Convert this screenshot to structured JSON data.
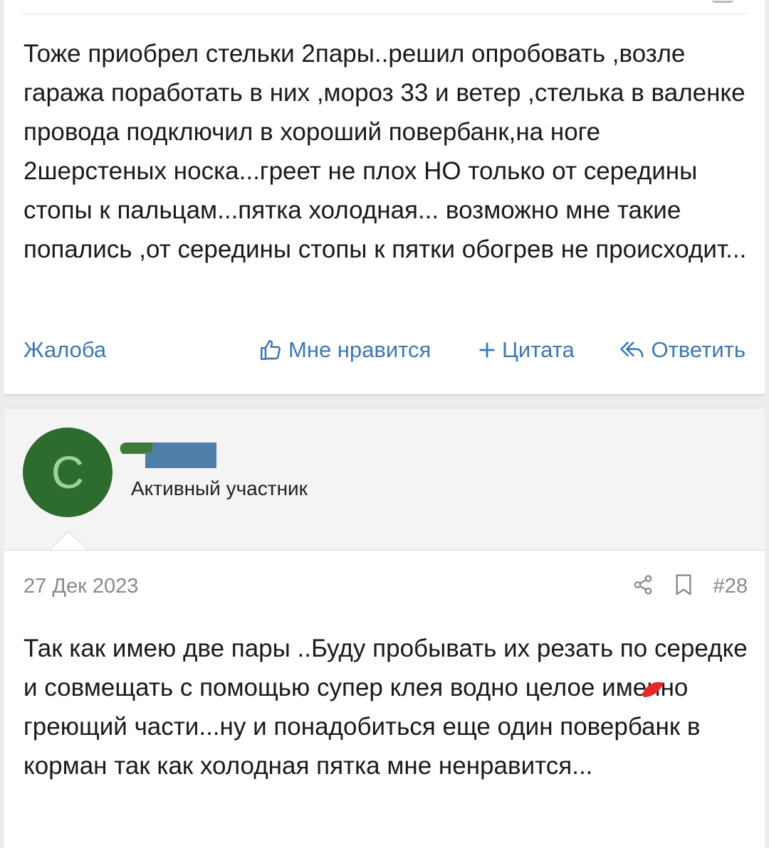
{
  "post1": {
    "text": "Тоже приобрел стельки 2пары..решил опробовать ,возле гаража поработать в них ,мороз 33 и ветер ,стелька в валенке провода подключил в хороший повербанк,на ноге 2шерстеных носка...греет не плох НО только от середины стопы к пальцам...пятка холодная... возможно мне такие попались ,от середины стопы к пятки обогрев не происходит...",
    "actions": {
      "report_label": "Жалоба",
      "like_label": "Мне нравится",
      "quote_label": "Цитата",
      "reply_label": "Ответить"
    }
  },
  "post2": {
    "avatar_letter": "C",
    "user_title": "Активный участник",
    "date": "27 Дек 2023",
    "post_number": "#28",
    "text": "Так как имею две пары ..Буду пробывать их резать по середке и совмещать с помощью супер клея водно целое именно греющий части...ну и понадобиться еще один повербанк в корман так как холодная пятка мне ненравится..."
  },
  "colors": {
    "link": "#3e78b4",
    "avatar_bg": "#2e6b2e",
    "avatar_letter": "#9ad39a",
    "muted": "#8a8a8a",
    "redact_green": "#3f7a3a",
    "redact_blue": "#4f7ea8",
    "scribble_red": "#e22a2a"
  },
  "icons": {
    "like": "thumbs-up-icon",
    "quote": "plus-icon",
    "reply": "reply-arrow-icon",
    "share": "share-icon",
    "bookmark": "bookmark-icon"
  }
}
